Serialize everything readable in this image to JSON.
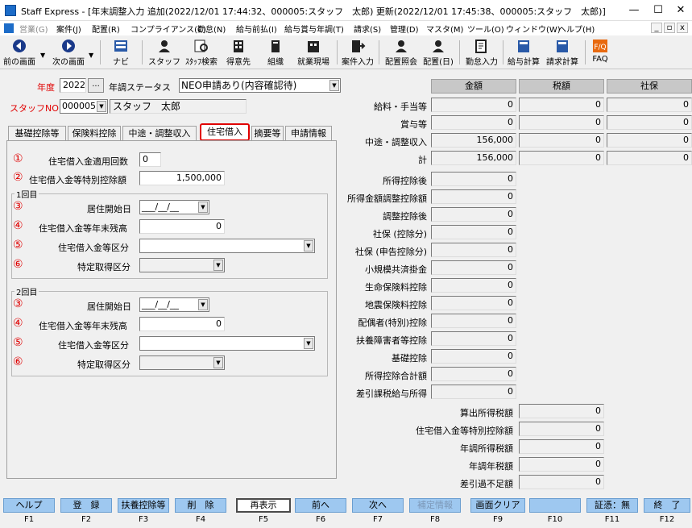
{
  "window": {
    "title": "Staff Express - [年末調整入力 追加(2022/12/01 17:44:32、000005:スタッフ　太郎) 更新(2022/12/01 17:45:38、000005:スタッフ　太郎)]",
    "minimize": "—",
    "maximize": "☐",
    "close": "✕"
  },
  "menu": {
    "items": [
      "営業(G)",
      "案件(J)",
      "配置(R)",
      "コンプライアンス(C)",
      "勤怠(N)",
      "給与前払(I)",
      "給与賞与年調(T)",
      "請求(S)",
      "管理(D)",
      "マスタ(M)",
      "ツール(O)",
      "ウィンドウ(W)",
      "ヘルプ(H)"
    ],
    "mdi": [
      "_",
      "▫",
      "x"
    ]
  },
  "toolbar": {
    "items": [
      "前の画面",
      "次の画面",
      "ナビ",
      "スタッフ",
      "ｽﾀｯﾌ検索",
      "得意先",
      "組織",
      "就業現場",
      "案件入力",
      "配置照会",
      "配置(日)",
      "勤怠入力",
      "給与計算",
      "請求計算",
      "FAQ"
    ]
  },
  "header": {
    "year_label": "年度",
    "year_value": "2022",
    "ellipsis": "...",
    "status_label": "年調ステータス",
    "status_value": "NEO申請あり(内容確認待)",
    "staff_label": "スタッフNO",
    "staff_no": "000005",
    "staff_name": "スタッフ　太郎"
  },
  "tabs": [
    "基礎控除等",
    "保険料控除",
    "中途・調整収入",
    "住宅借入",
    "摘要等",
    "申請情報"
  ],
  "loan": {
    "markers": [
      "①",
      "②",
      "③",
      "④",
      "⑤",
      "⑥"
    ],
    "count_label": "住宅借入金適用回数",
    "count_value": "0",
    "special_label": "住宅借入金等特別控除額",
    "special_value": "1,500,000",
    "g1_title": "1回目",
    "g2_title": "2回目",
    "start_label": "居住開始日",
    "date_placeholder": "___/__/__",
    "balance_label": "住宅借入金等年末残高",
    "balance_value": "0",
    "type_label": "住宅借入金等区分",
    "acq_label": "特定取得区分",
    "g2_balance_value": "0"
  },
  "summary": {
    "headers": [
      "金額",
      "税額",
      "社保"
    ],
    "rows": [
      {
        "label": "給料・手当等",
        "amount": "0",
        "tax": "0",
        "social": "0"
      },
      {
        "label": "賞与等",
        "amount": "0",
        "tax": "0",
        "social": "0"
      },
      {
        "label": "中途・調整収入",
        "amount": "156,000",
        "tax": "0",
        "social": "0"
      },
      {
        "label": "計",
        "amount": "156,000",
        "tax": "0",
        "social": "0"
      }
    ],
    "deductions": [
      {
        "label": "所得控除後",
        "value": "0"
      },
      {
        "label": "所得金額調整控除額",
        "value": "0"
      },
      {
        "label": "調整控除後",
        "value": "0"
      },
      {
        "label": "社保 (控除分)",
        "value": "0"
      },
      {
        "label": "社保 (申告控除分)",
        "value": "0"
      },
      {
        "label": "小規模共済掛金",
        "value": "0"
      },
      {
        "label": "生命保険料控除",
        "value": "0"
      },
      {
        "label": "地震保険料控除",
        "value": "0"
      },
      {
        "label": "配偶者(特別)控除",
        "value": "0"
      },
      {
        "label": "扶養障害者等控除",
        "value": "0"
      },
      {
        "label": "基礎控除",
        "value": "0"
      },
      {
        "label": "所得控除合計額",
        "value": "0"
      },
      {
        "label": "差引課税給与所得",
        "value": "0"
      }
    ],
    "taxes": [
      {
        "label": "算出所得税額",
        "value": "0"
      },
      {
        "label": "住宅借入金等特別控除額",
        "value": "0"
      },
      {
        "label": "年調所得税額",
        "value": "0"
      },
      {
        "label": "年調年税額",
        "value": "0"
      },
      {
        "label": "差引過不足額",
        "value": "0"
      }
    ]
  },
  "fkeys": [
    {
      "label": "ヘルプ",
      "key": "F1"
    },
    {
      "label": "登　録",
      "key": "F2"
    },
    {
      "label": "扶養控除等",
      "key": "F3"
    },
    {
      "label": "削　除",
      "key": "F4"
    },
    {
      "label": "再表示",
      "key": "F5"
    },
    {
      "label": "前へ",
      "key": "F6"
    },
    {
      "label": "次へ",
      "key": "F7"
    },
    {
      "label": "補定情報",
      "key": "F8"
    },
    {
      "label": "画面クリア",
      "key": "F9"
    },
    {
      "label": "",
      "key": "F10"
    },
    {
      "label": "証憑：無",
      "key": "F11"
    },
    {
      "label": "終　了",
      "key": "F12"
    }
  ]
}
